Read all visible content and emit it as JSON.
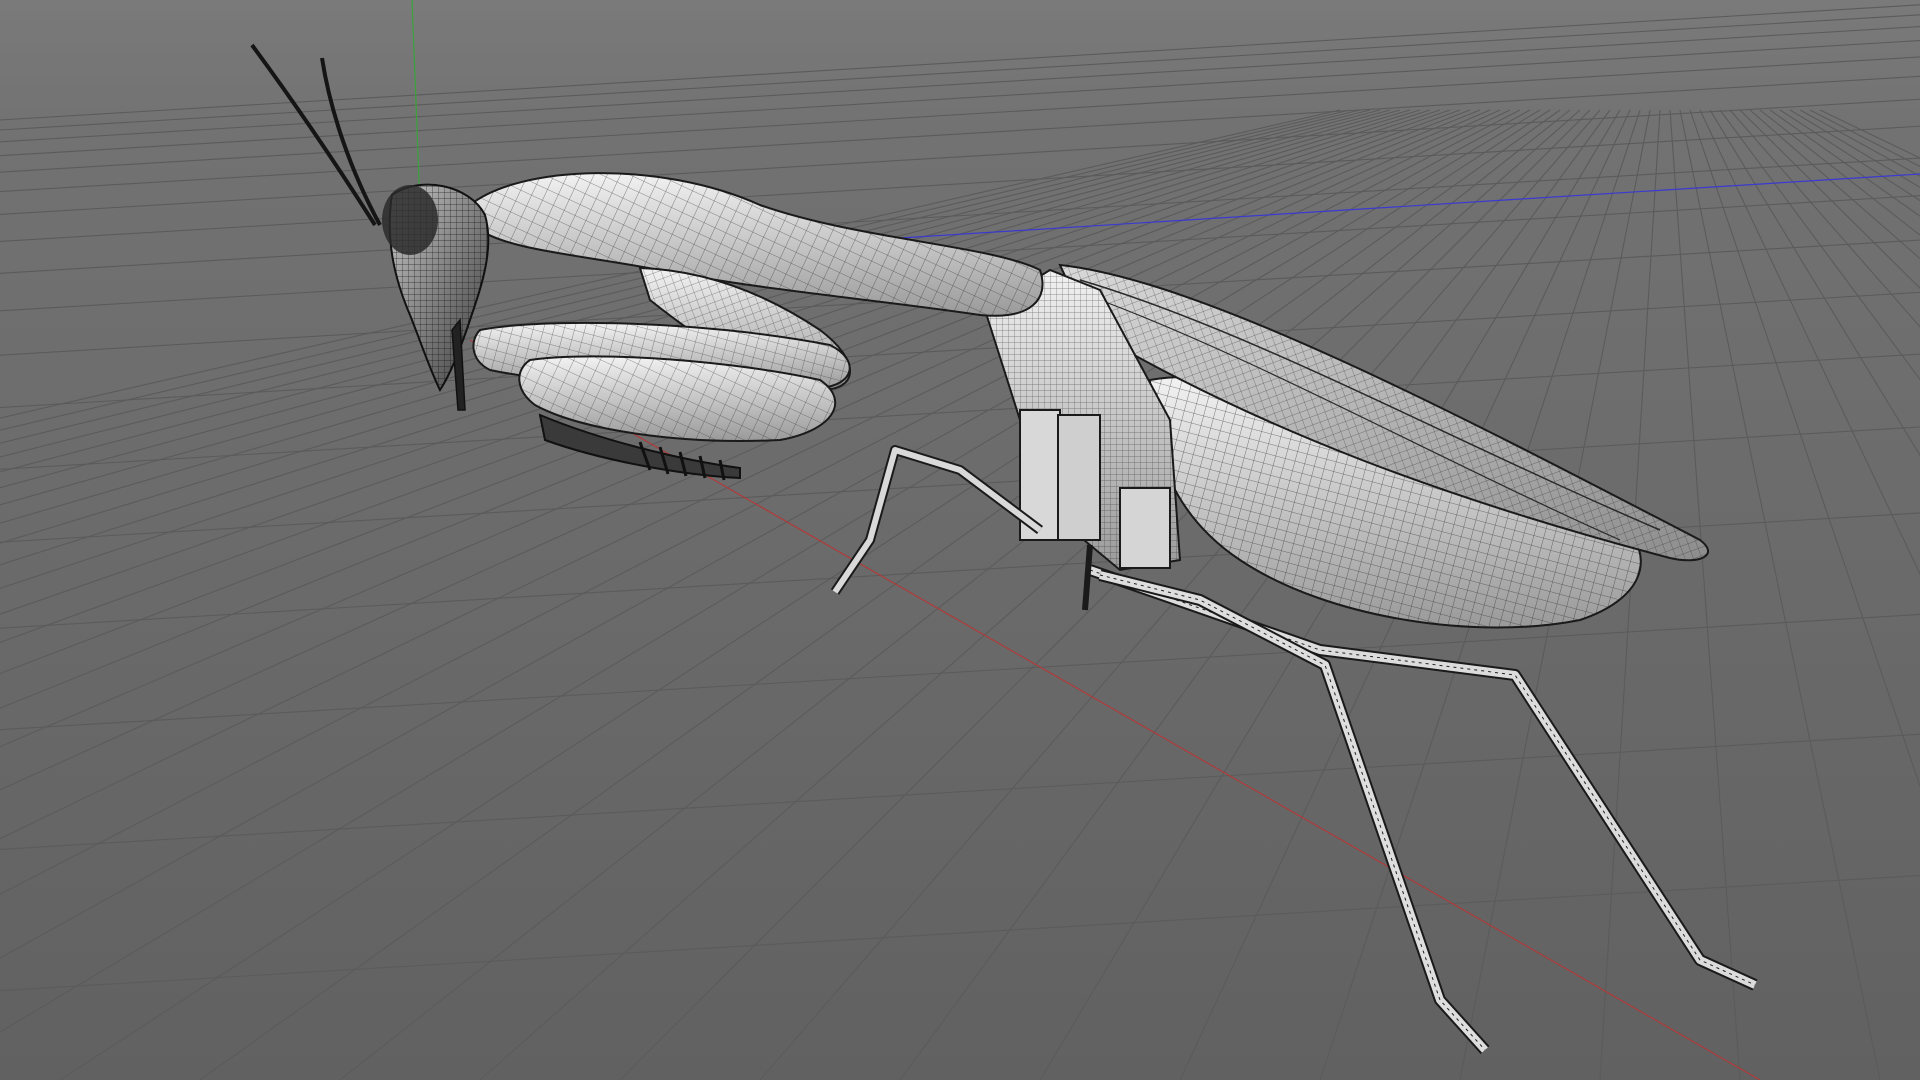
{
  "viewport": {
    "background_color": "#6f6f6f",
    "grid_color": "#5b5b5b",
    "axis_colors": {
      "x": "#b03a3a",
      "y": "#3aa33a",
      "z": "#3a3ad0"
    },
    "shading": "gouraud-lines"
  },
  "scene": {
    "object": "praying-mantis-model",
    "mesh_color": "#e8e8e8",
    "wire_color": "#202020"
  }
}
